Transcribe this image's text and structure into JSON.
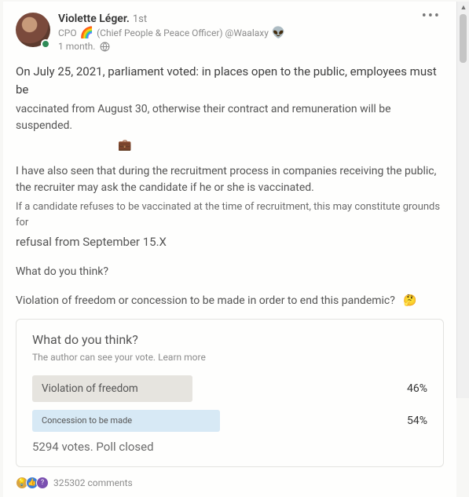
{
  "author": {
    "name": "Violette Léger.",
    "degree": "1st",
    "subtitle_prefix": "CPO",
    "subtitle_rest": "(Chief People & Peace Officer) @Waalaxy",
    "posted": "1 month.",
    "rainbow_emoji": "🌈",
    "alien_emoji": "👽"
  },
  "post": {
    "line1": "On July 25, 2021, parliament voted: in places open to the public, employees must be",
    "line2": "vaccinated from August 30, otherwise their contract and remuneration will be suspended.",
    "briefcase": "💼",
    "line3": "I have also seen that during the recruitment process in companies receiving the public, the recruiter may ask the candidate if he or she is vaccinated.",
    "line4": "If a candidate refuses to be vaccinated at the time of recruitment, this may constitute grounds for",
    "line5": "refusal from September 15.X",
    "q1": "What do you think?",
    "q2": "Violation of freedom or concession to be made in order to end this pandemic?",
    "thinking": "🤔"
  },
  "poll": {
    "title": "What do you think?",
    "subtitle_a": "The author can see your vote.",
    "subtitle_b": "Learn more",
    "options": [
      {
        "label": "Violation of freedom",
        "pct": "46%"
      },
      {
        "label": "Concession to be made",
        "pct": "54%"
      }
    ],
    "footer": "5294 votes. Poll closed"
  },
  "reactions": {
    "count": "325302 comments"
  }
}
